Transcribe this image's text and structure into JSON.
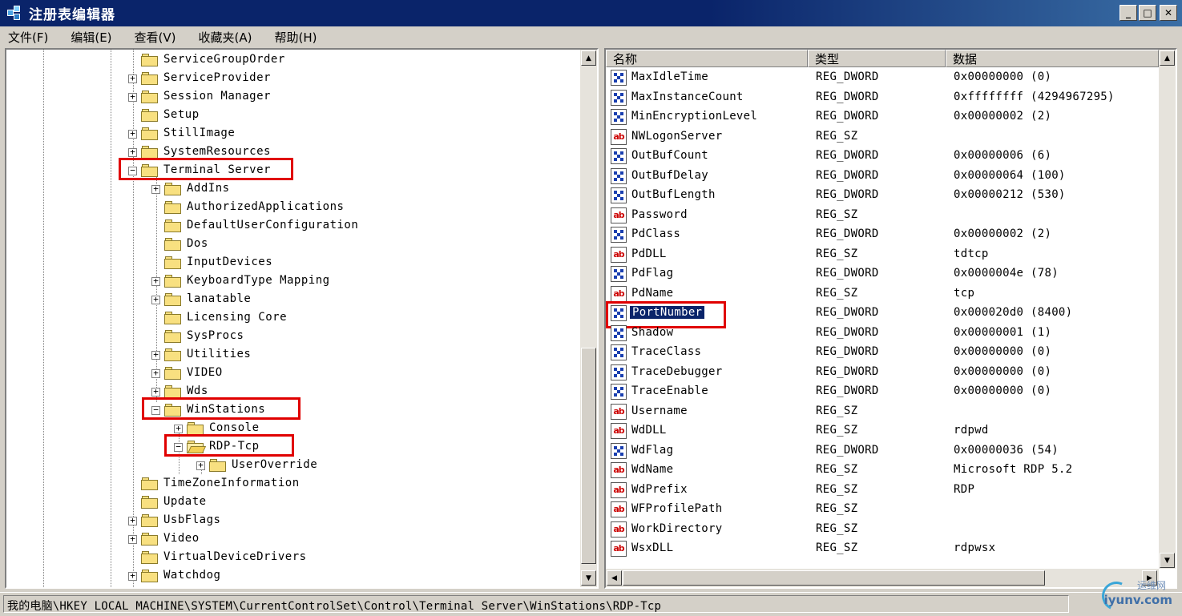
{
  "window": {
    "title": "注册表编辑器"
  },
  "title_buttons": {
    "minimize": "_",
    "maximize": "□",
    "close": "✕"
  },
  "menu": [
    "文件(F)",
    "编辑(E)",
    "查看(V)",
    "收藏夹(A)",
    "帮助(H)"
  ],
  "tree": {
    "items": [
      {
        "label": "ServiceGroupOrder",
        "level": 0,
        "expander": "none"
      },
      {
        "label": "ServiceProvider",
        "level": 0,
        "expander": "+"
      },
      {
        "label": "Session Manager",
        "level": 0,
        "expander": "+"
      },
      {
        "label": "Setup",
        "level": 0,
        "expander": "none"
      },
      {
        "label": "StillImage",
        "level": 0,
        "expander": "+"
      },
      {
        "label": "SystemResources",
        "level": 0,
        "expander": "+"
      },
      {
        "label": "Terminal Server",
        "level": 0,
        "expander": "-",
        "highlighted": true
      },
      {
        "label": "AddIns",
        "level": 1,
        "expander": "+"
      },
      {
        "label": "AuthorizedApplications",
        "level": 1,
        "expander": "none"
      },
      {
        "label": "DefaultUserConfiguration",
        "level": 1,
        "expander": "none"
      },
      {
        "label": "Dos",
        "level": 1,
        "expander": "none"
      },
      {
        "label": "InputDevices",
        "level": 1,
        "expander": "none"
      },
      {
        "label": "KeyboardType Mapping",
        "level": 1,
        "expander": "+"
      },
      {
        "label": "lanatable",
        "level": 1,
        "expander": "+"
      },
      {
        "label": "Licensing Core",
        "level": 1,
        "expander": "none"
      },
      {
        "label": "SysProcs",
        "level": 1,
        "expander": "none"
      },
      {
        "label": "Utilities",
        "level": 1,
        "expander": "+"
      },
      {
        "label": "VIDEO",
        "level": 1,
        "expander": "+"
      },
      {
        "label": "Wds",
        "level": 1,
        "expander": "+"
      },
      {
        "label": "WinStations",
        "level": 1,
        "expander": "-",
        "highlighted": true
      },
      {
        "label": "Console",
        "level": 2,
        "expander": "+"
      },
      {
        "label": "RDP-Tcp",
        "level": 2,
        "expander": "-",
        "highlighted": true,
        "open": true
      },
      {
        "label": "UserOverride",
        "level": 3,
        "expander": "+"
      },
      {
        "label": "TimeZoneInformation",
        "level": 0,
        "expander": "none"
      },
      {
        "label": "Update",
        "level": 0,
        "expander": "none"
      },
      {
        "label": "UsbFlags",
        "level": 0,
        "expander": "+"
      },
      {
        "label": "Video",
        "level": 0,
        "expander": "+"
      },
      {
        "label": "VirtualDeviceDrivers",
        "level": 0,
        "expander": "none"
      },
      {
        "label": "Watchdog",
        "level": 0,
        "expander": "+"
      }
    ]
  },
  "list": {
    "columns": [
      "名称",
      "类型",
      "数据"
    ],
    "rows": [
      {
        "name": "MaxIdleTime",
        "type": "REG_DWORD",
        "data": "0x00000000 (0)",
        "icon": "dword-icon"
      },
      {
        "name": "MaxInstanceCount",
        "type": "REG_DWORD",
        "data": "0xffffffff (4294967295)",
        "icon": "dword-icon"
      },
      {
        "name": "MinEncryptionLevel",
        "type": "REG_DWORD",
        "data": "0x00000002 (2)",
        "icon": "dword-icon"
      },
      {
        "name": "NWLogonServer",
        "type": "REG_SZ",
        "data": "",
        "icon": "string-icon"
      },
      {
        "name": "OutBufCount",
        "type": "REG_DWORD",
        "data": "0x00000006 (6)",
        "icon": "dword-icon"
      },
      {
        "name": "OutBufDelay",
        "type": "REG_DWORD",
        "data": "0x00000064 (100)",
        "icon": "dword-icon"
      },
      {
        "name": "OutBufLength",
        "type": "REG_DWORD",
        "data": "0x00000212 (530)",
        "icon": "dword-icon"
      },
      {
        "name": "Password",
        "type": "REG_SZ",
        "data": "",
        "icon": "string-icon"
      },
      {
        "name": "PdClass",
        "type": "REG_DWORD",
        "data": "0x00000002 (2)",
        "icon": "dword-icon"
      },
      {
        "name": "PdDLL",
        "type": "REG_SZ",
        "data": "tdtcp",
        "icon": "string-icon"
      },
      {
        "name": "PdFlag",
        "type": "REG_DWORD",
        "data": "0x0000004e (78)",
        "icon": "dword-icon"
      },
      {
        "name": "PdName",
        "type": "REG_SZ",
        "data": "tcp",
        "icon": "string-icon"
      },
      {
        "name": "PortNumber",
        "type": "REG_DWORD",
        "data": "0x000020d0 (8400)",
        "icon": "dword-icon",
        "selected": true
      },
      {
        "name": "Shadow",
        "type": "REG_DWORD",
        "data": "0x00000001 (1)",
        "icon": "dword-icon"
      },
      {
        "name": "TraceClass",
        "type": "REG_DWORD",
        "data": "0x00000000 (0)",
        "icon": "dword-icon"
      },
      {
        "name": "TraceDebugger",
        "type": "REG_DWORD",
        "data": "0x00000000 (0)",
        "icon": "dword-icon"
      },
      {
        "name": "TraceEnable",
        "type": "REG_DWORD",
        "data": "0x00000000 (0)",
        "icon": "dword-icon"
      },
      {
        "name": "Username",
        "type": "REG_SZ",
        "data": "",
        "icon": "string-icon"
      },
      {
        "name": "WdDLL",
        "type": "REG_SZ",
        "data": "rdpwd",
        "icon": "string-icon"
      },
      {
        "name": "WdFlag",
        "type": "REG_DWORD",
        "data": "0x00000036 (54)",
        "icon": "dword-icon"
      },
      {
        "name": "WdName",
        "type": "REG_SZ",
        "data": "Microsoft RDP 5.2",
        "icon": "string-icon"
      },
      {
        "name": "WdPrefix",
        "type": "REG_SZ",
        "data": "RDP",
        "icon": "string-icon"
      },
      {
        "name": "WFProfilePath",
        "type": "REG_SZ",
        "data": "",
        "icon": "string-icon"
      },
      {
        "name": "WorkDirectory",
        "type": "REG_SZ",
        "data": "",
        "icon": "string-icon"
      },
      {
        "name": "WsxDLL",
        "type": "REG_SZ",
        "data": "rdpwsx",
        "icon": "string-icon"
      }
    ]
  },
  "status": {
    "path": "我的电脑\\HKEY_LOCAL_MACHINE\\SYSTEM\\CurrentControlSet\\Control\\Terminal Server\\WinStations\\RDP-Tcp"
  },
  "watermark": {
    "line1": "运维网",
    "line2": "iyunv.com"
  },
  "icons": {
    "sz_text": "ab"
  },
  "colors": {
    "title_bg": "#0a246a",
    "highlight_box": "#e00000",
    "selection_bg": "#0a246a"
  }
}
